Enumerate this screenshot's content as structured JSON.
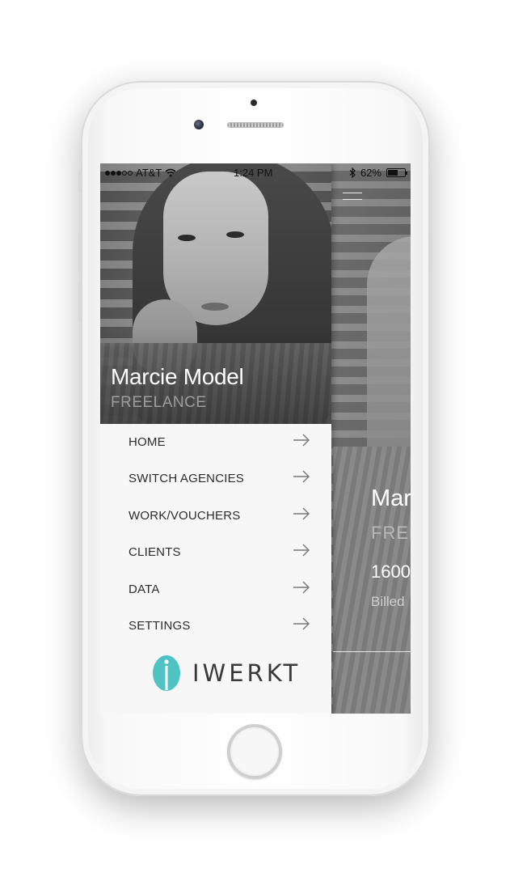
{
  "status_bar": {
    "signal_dots_filled": 3,
    "signal_dots_total": 5,
    "carrier": "AT&T",
    "time": "1:24 PM",
    "battery_text": "62%",
    "battery_level": 0.62,
    "icons": [
      "wifi-icon",
      "bluetooth-icon",
      "battery-icon"
    ]
  },
  "drawer": {
    "user_name": "Marcie Model",
    "user_status": "FREELANCE",
    "menu": [
      {
        "label": "HOME",
        "icon": "arrow-right-icon"
      },
      {
        "label": "SWITCH AGENCIES",
        "icon": "arrow-right-icon"
      },
      {
        "label": "WORK/VOUCHERS",
        "icon": "arrow-right-icon"
      },
      {
        "label": "CLIENTS",
        "icon": "arrow-right-icon"
      },
      {
        "label": "DATA",
        "icon": "arrow-right-icon"
      },
      {
        "label": "SETTINGS",
        "icon": "arrow-right-icon"
      }
    ],
    "logo_text": "IWERKT"
  },
  "main_screen": {
    "name_partial": "Mar",
    "status_partial": "FREE",
    "amount_partial": "1600",
    "billed_partial": "Billed"
  },
  "colors": {
    "accent": "#4fc3c3",
    "drawer_bg": "#f7f7f7",
    "menu_text": "#2c2c2c"
  }
}
